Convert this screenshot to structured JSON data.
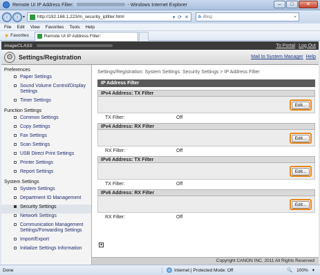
{
  "browser": {
    "window_title_prefix": "Remote UI IP Address Filter:",
    "window_title_suffix": "- Windows Internet Explorer",
    "window_buttons": [
      "–",
      "□",
      "✕"
    ],
    "url": "http://192.168.1.223/m_security_ipfilter.html",
    "search_placeholder": "Bing",
    "search_brand": "b",
    "menu": [
      "File",
      "Edit",
      "View",
      "Favorites",
      "Tools",
      "Help"
    ],
    "favorites_label": "Favorites",
    "tab_title": "Remote UI IP Address Filter:",
    "status_left": "Done",
    "status_zone": "Internet | Protected Mode: Off",
    "zoom": "100%"
  },
  "app": {
    "brand": "imageCLASS",
    "top_links": [
      "To Portal",
      "Log Out"
    ],
    "page_header": "Settings/Registration",
    "header_links": [
      "Mail to System Manager",
      "Help"
    ]
  },
  "sidebar": {
    "sections": [
      {
        "title": "Preferences",
        "items": [
          "Paper Settings",
          "Sound Volume Control/Display Settings",
          "Timer Settings"
        ]
      },
      {
        "title": "Function Settings",
        "items": [
          "Common Settings",
          "Copy Settings",
          "Fax Settings",
          "Scan Settings",
          "USB Direct Print Settings",
          "Printer Settings",
          "Report Settings"
        ]
      },
      {
        "title": "System Settings",
        "items": [
          "System Settings",
          "Department ID Management",
          "Security Settings",
          "Network Settings",
          "Communication Management Settings/Forwarding Settings",
          "Import/Export",
          "Initialize Settings Information"
        ]
      }
    ],
    "active_item": "Security Settings"
  },
  "main": {
    "breadcrumb": "Settings/Registration: System Settings: Security Settings > IP Address Filter",
    "page_title": "IP Address Filter",
    "groups": [
      {
        "title": "IPv4 Address: TX Filter",
        "edit_label": "Edit...",
        "row_label": "TX Filter:",
        "row_value": "Off"
      },
      {
        "title": "IPv4 Address: RX Filter",
        "edit_label": "Edit...",
        "row_label": "RX Filter:",
        "row_value": "Off"
      },
      {
        "title": "IPv6 Address: TX Filter",
        "edit_label": "Edit...",
        "row_label": "TX Filter:",
        "row_value": "Off"
      },
      {
        "title": "IPv6 Address: RX Filter",
        "edit_label": "Edit...",
        "row_label": "RX Filter:",
        "row_value": "Off"
      }
    ],
    "scroll_top_glyph": "▲"
  },
  "footer": {
    "copyright": "Copyright CANON INC. 2011 All Rights Reserved"
  },
  "colors": {
    "edit_highlight": "#e8861a",
    "page_title_bar": "#5a5a5a",
    "link": "#1a3a8a"
  }
}
